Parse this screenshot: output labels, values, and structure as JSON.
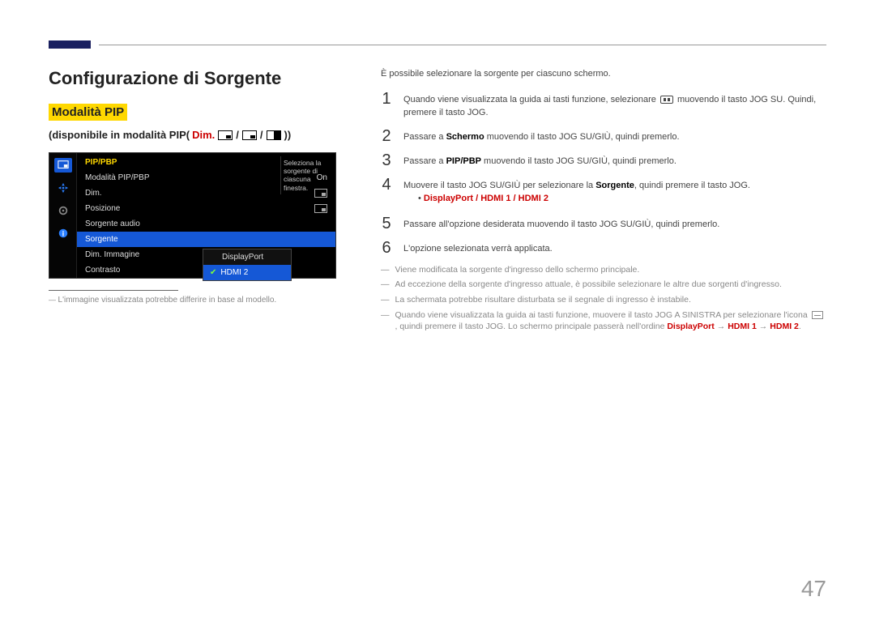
{
  "page_number": "47",
  "h1": "Configurazione di Sorgente",
  "mode_label": "Modalità PIP",
  "avail_prefix": "(disponibile in modalità PIP(",
  "avail_dim": "Dim.",
  "avail_suffix": "))",
  "osd": {
    "title": "PIP/PBP",
    "tip": "Seleziona la sorgente di ciascuna finestra.",
    "rows": {
      "r0": {
        "label": "Modalità PIP/PBP",
        "value": "On"
      },
      "r1": {
        "label": "Dim."
      },
      "r2": {
        "label": "Posizione"
      },
      "r3": {
        "label": "Sorgente audio"
      },
      "r4": {
        "label": "Sorgente"
      },
      "r5": {
        "label": "Dim. Immagine"
      },
      "r6": {
        "label": "Contrasto"
      }
    },
    "popup": {
      "p0": "DisplayPort",
      "p1": "HDMI 2"
    }
  },
  "caption": "L'immagine visualizzata potrebbe differire in base al modello.",
  "intro": "È possibile selezionare la sorgente per ciascuno schermo.",
  "steps": {
    "s1a": "Quando viene visualizzata la guida ai tasti funzione, selezionare ",
    "s1b": " muovendo il tasto JOG SU. Quindi, premere il tasto JOG.",
    "s2a": "Passare a ",
    "s2b": "Schermo",
    "s2c": " muovendo il tasto JOG SU/GIÙ, quindi premerlo.",
    "s3a": "Passare a ",
    "s3b": "PIP/PBP",
    "s3c": " muovendo il tasto JOG SU/GIÙ, quindi premerlo.",
    "s4a": "Muovere il tasto JOG SU/GIÙ per selezionare la ",
    "s4b": "Sorgente",
    "s4c": ", quindi premere il tasto JOG.",
    "optline": "DisplayPort / HDMI 1 / HDMI 2",
    "s5": "Passare all'opzione desiderata muovendo il tasto JOG SU/GIÙ, quindi premerlo.",
    "s6": "L'opzione selezionata verrà applicata."
  },
  "notes": {
    "n1": "Viene modificata la sorgente d'ingresso dello schermo principale.",
    "n2": "Ad eccezione della sorgente d'ingresso attuale, è possibile selezionare le altre due sorgenti d'ingresso.",
    "n3": "La schermata potrebbe risultare disturbata se il segnale di ingresso è instabile.",
    "n4a": "Quando viene visualizzata la guida ai tasti funzione, muovere il tasto JOG A SINISTRA per selezionare l'icona ",
    "n4b": ", quindi premere il tasto JOG. Lo schermo principale passerà nell'ordine ",
    "seq1": "DisplayPort",
    "seq2": "HDMI 1",
    "seq3": "HDMI 2"
  }
}
